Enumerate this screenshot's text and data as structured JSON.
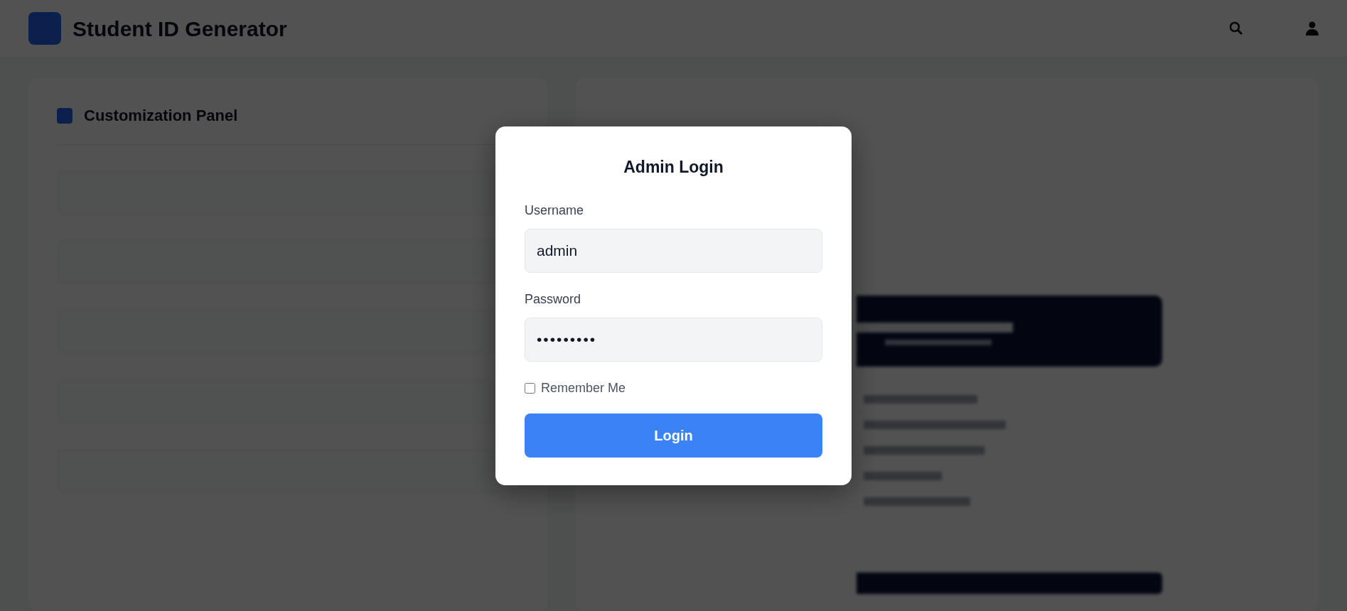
{
  "app": {
    "title": "Student ID Generator"
  },
  "left_panel": {
    "title": "Customization Panel"
  },
  "login_dialog": {
    "title": "Admin Login",
    "fields": [
      {
        "label": "Username",
        "value": "admin",
        "kind": "text"
      },
      {
        "label": "Password",
        "value": "•••••••••",
        "kind": "password"
      }
    ],
    "remember": {
      "label": "Remember Me",
      "checked": false
    },
    "button": "Login"
  }
}
